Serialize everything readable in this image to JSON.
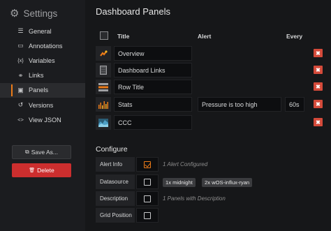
{
  "sidebar": {
    "title": "Settings",
    "items": [
      {
        "label": "General",
        "icon": "sliders-icon"
      },
      {
        "label": "Annotations",
        "icon": "comment-icon"
      },
      {
        "label": "Variables",
        "icon": "braces-icon"
      },
      {
        "label": "Links",
        "icon": "link-icon"
      },
      {
        "label": "Panels",
        "icon": "panel-icon",
        "active": true
      },
      {
        "label": "Versions",
        "icon": "history-icon"
      },
      {
        "label": "View JSON",
        "icon": "code-icon"
      }
    ],
    "save_as_label": "Save As...",
    "delete_label": "Delete"
  },
  "main": {
    "title": "Dashboard Panels",
    "columns": {
      "title": "Title",
      "alert": "Alert",
      "every": "Every"
    },
    "panels": [
      {
        "title": "Overview",
        "icon": "singlestat-icon",
        "alert": "",
        "every": ""
      },
      {
        "title": "Dashboard Links",
        "icon": "dashlist-icon",
        "alert": "",
        "every": ""
      },
      {
        "title": "Row Title",
        "icon": "row-icon",
        "alert": "",
        "every": ""
      },
      {
        "title": "Stats",
        "icon": "graph-icon",
        "alert": "Pressure is too high",
        "every": "60s"
      },
      {
        "title": "CCC",
        "icon": "heatmap-icon",
        "alert": "",
        "every": ""
      }
    ],
    "configure": {
      "title": "Configure",
      "rows": [
        {
          "label": "Alert Info",
          "checked": true,
          "note": "1 Alert Configured"
        },
        {
          "label": "Datasource",
          "checked": false,
          "tags": [
            "1x midnight",
            "2x wOS-influx-ryan"
          ]
        },
        {
          "label": "Description",
          "checked": false,
          "note": "1 Panels with Description"
        },
        {
          "label": "Grid Position",
          "checked": false
        }
      ]
    }
  },
  "colors": {
    "accent": "#eb7b18",
    "danger": "#d44a3a",
    "delete_button": "#cc2e2e"
  }
}
